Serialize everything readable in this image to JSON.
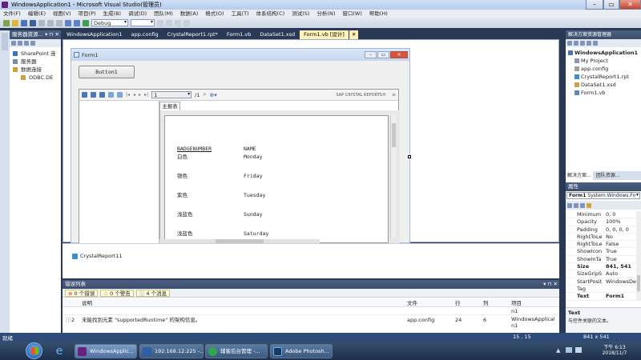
{
  "window": {
    "title": "WindowsApplication1 - Microsoft Visual Studio(管理员)"
  },
  "menu": [
    "文件(F)",
    "编辑(E)",
    "视图(V)",
    "项目(P)",
    "生成(B)",
    "调试(D)",
    "团队(M)",
    "数据(A)",
    "格式(O)",
    "工具(T)",
    "体系结构(C)",
    "测试(S)",
    "分析(N)",
    "窗口(W)",
    "帮助(H)"
  ],
  "toolbar": {
    "config": "Debug"
  },
  "server_explorer": {
    "title": "服务器资源...",
    "items": [
      "SharePoint 连",
      "服务器",
      "数据连接",
      "ODBC.DE"
    ]
  },
  "doc_tabs": [
    "WindowsApplication1",
    "app.config",
    "CrystalReport1.rpt*",
    "Form1.vb",
    "DataSet1.xsd",
    "Form1.vb [设计]"
  ],
  "form": {
    "title": "Form1",
    "button_label": "Button1",
    "viewer": {
      "page_input": "1",
      "page_total": "/1",
      "brand": "SAP CRYSTAL REPORTS®",
      "main_tab": "主报表",
      "report": {
        "headers": [
          "BADGENUMBER",
          "NAME"
        ],
        "rows": [
          [
            "白色",
            "Monday"
          ],
          [
            "银色",
            "Friday"
          ],
          [
            "紫色",
            "Tuesday"
          ],
          [
            "浅蓝色",
            "Sunday"
          ],
          [
            "浅蓝色",
            "Saturday"
          ]
        ]
      }
    }
  },
  "tray": {
    "component": "CrystalReport11"
  },
  "error_list": {
    "title": "错误列表",
    "filters": [
      "0 个错误",
      "0 个警告",
      "4 个消息"
    ],
    "columns": [
      "说明",
      "文件",
      "行",
      "列",
      "项目"
    ],
    "rows": [
      {
        "index": "",
        "desc": "",
        "file": "",
        "line": "",
        "col": "",
        "project": "n1"
      },
      {
        "index": "2",
        "desc": "未能找到元素 \"supportedRuntime\" 的架构信息。",
        "file": "app.config",
        "line": "24",
        "col": "6",
        "project": "WindowsApplicatio n1"
      }
    ]
  },
  "solution_explorer": {
    "title": "解决方案资源管理器",
    "items": [
      "WindowsApplication1",
      "My Project",
      "app.config",
      "CrystalReport1.rpt",
      "DataSet1.xsd",
      "Form1.vb"
    ],
    "tabs": [
      "解决方案...",
      "团队资源..."
    ]
  },
  "properties": {
    "title": "属性",
    "object": "Form1",
    "object_type": "System.Windows.Fo",
    "rows": [
      {
        "name": "Minimum",
        "value": "0, 0"
      },
      {
        "name": "Opacity",
        "value": "100%"
      },
      {
        "name": "Padding",
        "value": "0, 0, 0, 0"
      },
      {
        "name": "RightToLe",
        "value": "No"
      },
      {
        "name": "RightToLe",
        "value": "False"
      },
      {
        "name": "ShowIcon",
        "value": "True"
      },
      {
        "name": "ShowInTa",
        "value": "True"
      },
      {
        "name": "Size",
        "value": "841, 541"
      },
      {
        "name": "SizeGripS",
        "value": "Auto"
      },
      {
        "name": "StartPosit",
        "value": "WindowsDef"
      },
      {
        "name": "Tag",
        "value": ""
      },
      {
        "name": "Text",
        "value": "Form1"
      }
    ],
    "desc_title": "Text",
    "desc_text": "与控件关联的文本。"
  },
  "statusbar": {
    "ready": "就绪",
    "coords": "15 , 15",
    "size": "841 x 541"
  },
  "taskbar": {
    "buttons": [
      "WindowsApplic...",
      "192.168.12.225 -...",
      "辅客后台管理 -...",
      "Adobe Photosh..."
    ],
    "time": "下午 6:13",
    "date": "2018/11/7"
  }
}
